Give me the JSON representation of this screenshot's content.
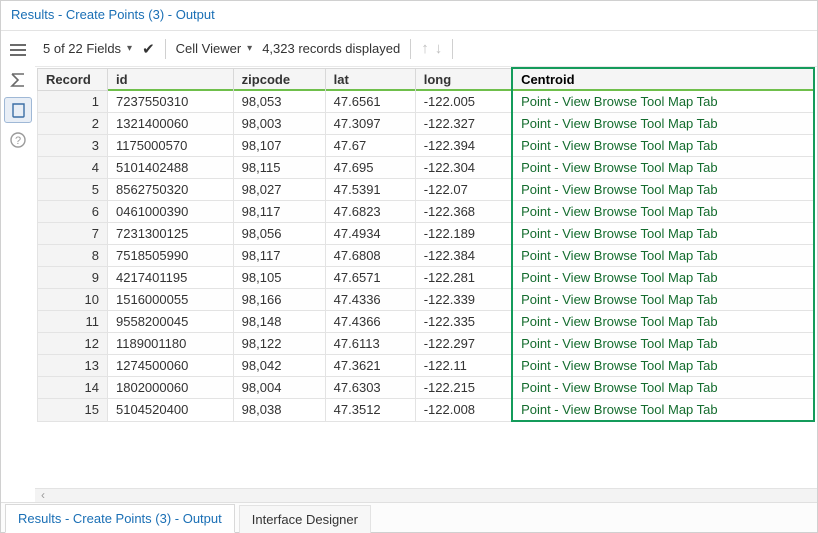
{
  "panel_title": "Results - Create Points (3) - Output",
  "toolbar": {
    "fields_label": "5 of 22 Fields",
    "cell_viewer_label": "Cell Viewer",
    "records_label": "4,323 records displayed"
  },
  "columns": {
    "record": "Record",
    "id": "id",
    "zipcode": "zipcode",
    "lat": "lat",
    "long": "long",
    "centroid": "Centroid"
  },
  "rows": [
    {
      "n": "1",
      "id": "7237550310",
      "zip": "98,053",
      "lat": "47.6561",
      "long": "-122.005",
      "cent": "Point - View Browse Tool Map Tab"
    },
    {
      "n": "2",
      "id": "1321400060",
      "zip": "98,003",
      "lat": "47.3097",
      "long": "-122.327",
      "cent": "Point - View Browse Tool Map Tab"
    },
    {
      "n": "3",
      "id": "1175000570",
      "zip": "98,107",
      "lat": "47.67",
      "long": "-122.394",
      "cent": "Point - View Browse Tool Map Tab"
    },
    {
      "n": "4",
      "id": "5101402488",
      "zip": "98,115",
      "lat": "47.695",
      "long": "-122.304",
      "cent": "Point - View Browse Tool Map Tab"
    },
    {
      "n": "5",
      "id": "8562750320",
      "zip": "98,027",
      "lat": "47.5391",
      "long": "-122.07",
      "cent": "Point - View Browse Tool Map Tab"
    },
    {
      "n": "6",
      "id": "0461000390",
      "zip": "98,117",
      "lat": "47.6823",
      "long": "-122.368",
      "cent": "Point - View Browse Tool Map Tab"
    },
    {
      "n": "7",
      "id": "7231300125",
      "zip": "98,056",
      "lat": "47.4934",
      "long": "-122.189",
      "cent": "Point - View Browse Tool Map Tab"
    },
    {
      "n": "8",
      "id": "7518505990",
      "zip": "98,117",
      "lat": "47.6808",
      "long": "-122.384",
      "cent": "Point - View Browse Tool Map Tab"
    },
    {
      "n": "9",
      "id": "4217401195",
      "zip": "98,105",
      "lat": "47.6571",
      "long": "-122.281",
      "cent": "Point - View Browse Tool Map Tab"
    },
    {
      "n": "10",
      "id": "1516000055",
      "zip": "98,166",
      "lat": "47.4336",
      "long": "-122.339",
      "cent": "Point - View Browse Tool Map Tab"
    },
    {
      "n": "11",
      "id": "9558200045",
      "zip": "98,148",
      "lat": "47.4366",
      "long": "-122.335",
      "cent": "Point - View Browse Tool Map Tab"
    },
    {
      "n": "12",
      "id": "1189001180",
      "zip": "98,122",
      "lat": "47.6113",
      "long": "-122.297",
      "cent": "Point - View Browse Tool Map Tab"
    },
    {
      "n": "13",
      "id": "1274500060",
      "zip": "98,042",
      "lat": "47.3621",
      "long": "-122.11",
      "cent": "Point - View Browse Tool Map Tab"
    },
    {
      "n": "14",
      "id": "1802000060",
      "zip": "98,004",
      "lat": "47.6303",
      "long": "-122.215",
      "cent": "Point - View Browse Tool Map Tab"
    },
    {
      "n": "15",
      "id": "5104520400",
      "zip": "98,038",
      "lat": "47.3512",
      "long": "-122.008",
      "cent": "Point - View Browse Tool Map Tab"
    }
  ],
  "tabs": {
    "active": "Results - Create Points (3) - Output",
    "inactive": "Interface Designer"
  }
}
